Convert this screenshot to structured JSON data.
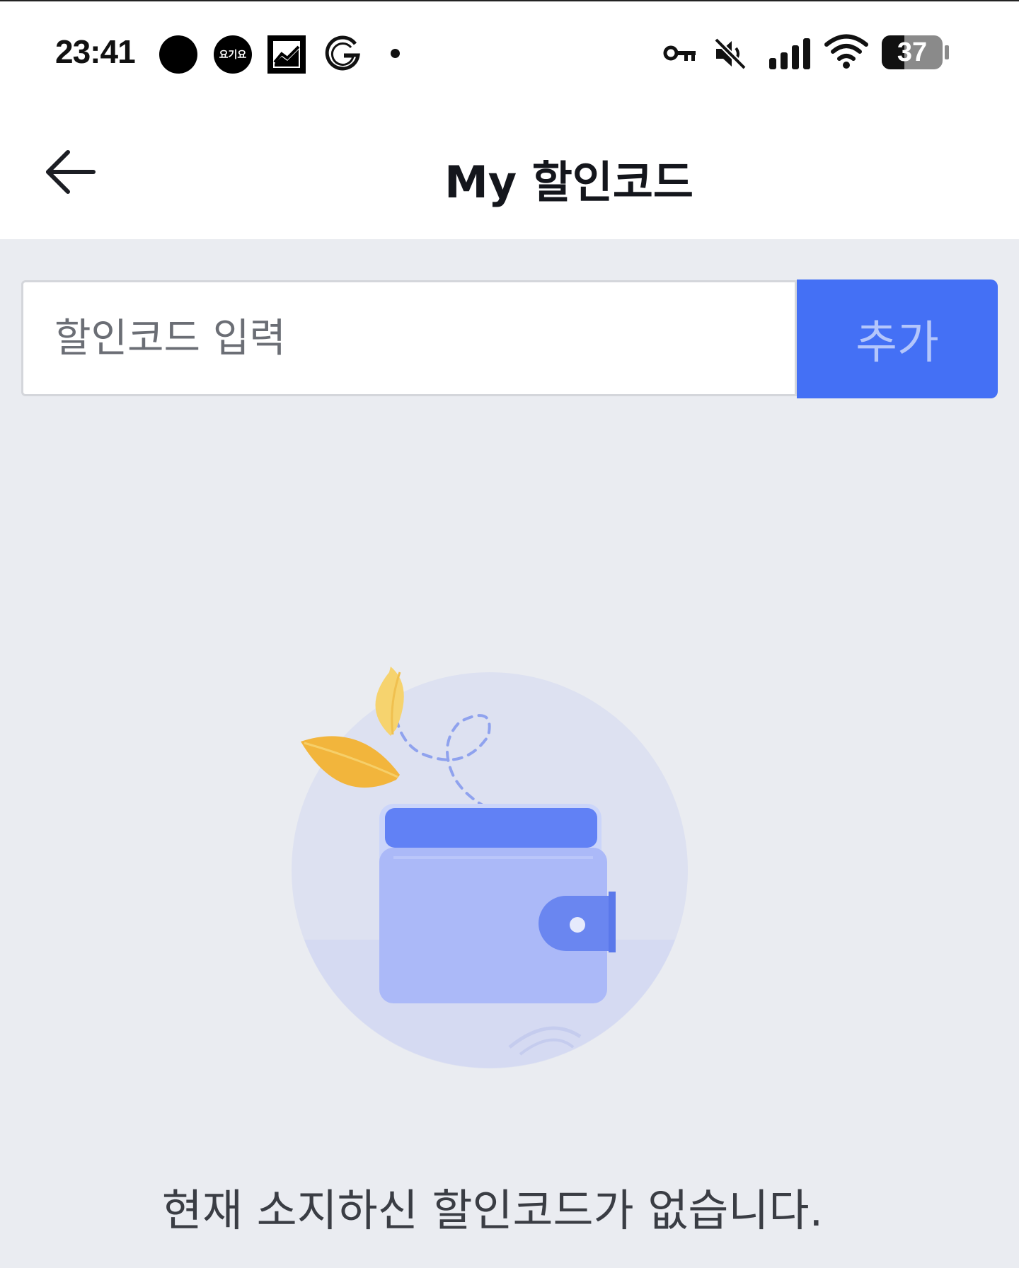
{
  "status_bar": {
    "time": "23:41",
    "app_icon_label": "요기요",
    "battery_level": "37",
    "battery_fraction": 0.37,
    "icons": [
      "circle-icon",
      "yogiyo-icon",
      "stock-chart-icon",
      "google-icon",
      "notification-dot-icon",
      "vpn-key-icon",
      "mute-icon",
      "signal-icon",
      "wifi-icon",
      "battery-icon"
    ]
  },
  "header": {
    "back_icon": "arrow-left-icon",
    "title": "My 할인코드"
  },
  "code_form": {
    "placeholder": "할인코드 입력",
    "value": "",
    "add_label": "추가"
  },
  "empty_state": {
    "illustration": "wallet-icon",
    "message": "현재 소지하신 할인코드가 없습니다."
  },
  "colors": {
    "accent": "#4470f5",
    "background": "#eaecf1",
    "header_bg": "#ffffff",
    "leaf": "#f2b53c",
    "wallet": "#abb9f8"
  }
}
